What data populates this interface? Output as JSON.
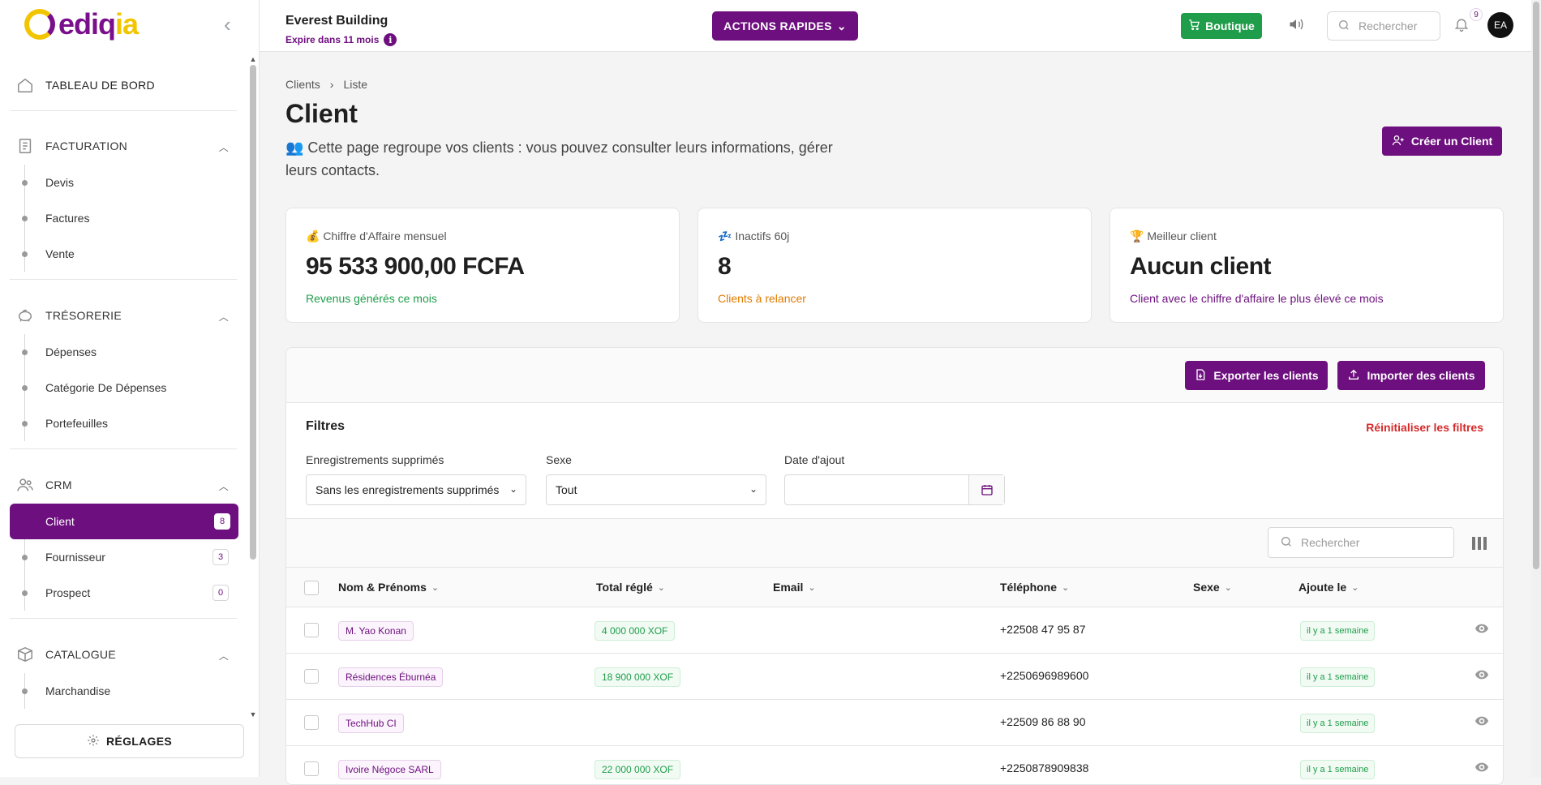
{
  "brand": {
    "logo_main": "ediq",
    "logo_accent": "ia"
  },
  "sidebar": {
    "dashboard": "TABLEAU DE BORD",
    "sections": [
      {
        "title": "FACTURATION",
        "items": [
          {
            "label": "Devis"
          },
          {
            "label": "Factures"
          },
          {
            "label": "Vente"
          }
        ]
      },
      {
        "title": "TRÉSORERIE",
        "items": [
          {
            "label": "Dépenses"
          },
          {
            "label": "Catégorie De Dépenses"
          },
          {
            "label": "Portefeuilles"
          }
        ]
      },
      {
        "title": "CRM",
        "items": [
          {
            "label": "Client",
            "count": "8",
            "active": true
          },
          {
            "label": "Fournisseur",
            "count": "3"
          },
          {
            "label": "Prospect",
            "count": "0"
          }
        ]
      },
      {
        "title": "CATALOGUE",
        "items": [
          {
            "label": "Marchandise"
          }
        ]
      }
    ],
    "settings": "RÉGLAGES"
  },
  "topbar": {
    "building": "Everest Building",
    "expire": "Expire dans 11 mois",
    "actions": "ACTIONS RAPIDES",
    "boutique": "Boutique",
    "search_placeholder": "Rechercher",
    "notif_count": "9",
    "avatar": "EA"
  },
  "page": {
    "breadcrumb": [
      "Clients",
      "Liste"
    ],
    "title": "Client",
    "description": "👥 Cette page regroupe vos clients : vous pouvez consulter leurs informations, gérer leurs contacts.",
    "create_button": "Créer un Client"
  },
  "cards": [
    {
      "label": "💰 Chiffre d'Affaire mensuel",
      "value": "95 533 900,00 FCFA",
      "sub": "Revenus générés ce mois",
      "sub_color": "#1f9d4a"
    },
    {
      "label": "💤 Inactifs 60j",
      "value": "8",
      "sub": "Clients à relancer",
      "sub_color": "#e07b00"
    },
    {
      "label": "🏆 Meilleur client",
      "value": "Aucun client",
      "sub": "Client avec le chiffre d'affaire le plus élevé ce mois",
      "sub_color": "#6d0f7e"
    }
  ],
  "panel": {
    "export": "Exporter les clients",
    "import": "Importer des clients",
    "filters_title": "Filtres",
    "reset": "Réinitialiser les filtres",
    "filter_deleted_label": "Enregistrements supprimés",
    "filter_deleted_value": "Sans les enregistrements supprimés",
    "filter_sex_label": "Sexe",
    "filter_sex_value": "Tout",
    "filter_date_label": "Date d'ajout",
    "table_search_placeholder": "Rechercher"
  },
  "table": {
    "columns": [
      "Nom & Prénoms",
      "Total réglé",
      "Email",
      "Téléphone",
      "Sexe",
      "Ajoute le"
    ],
    "rows": [
      {
        "name": "M. Yao Konan",
        "total": "4 000 000 XOF",
        "email": "",
        "phone": "+22508 47 95 87",
        "sex": "",
        "added": "il y a 1 semaine"
      },
      {
        "name": "Résidences Éburnéa",
        "total": "18 900 000 XOF",
        "email": "",
        "phone": "+2250696989600",
        "sex": "",
        "added": "il y a 1 semaine"
      },
      {
        "name": "TechHub CI",
        "total": "",
        "email": "",
        "phone": "+22509 86 88 90",
        "sex": "",
        "added": "il y a 1 semaine"
      },
      {
        "name": "Ivoire Négoce SARL",
        "total": "22 000 000 XOF",
        "email": "",
        "phone": "+2250878909838",
        "sex": "",
        "added": "il y a 1 semaine"
      }
    ]
  },
  "colors": {
    "accent": "#6d0f7e",
    "success": "#1f9d4a",
    "danger": "#d42a2a",
    "warning": "#e07b00"
  },
  "icons": [
    "home-icon",
    "invoice-icon",
    "piggy-bank-icon",
    "users-icon",
    "box-icon",
    "gear-icon",
    "chevron-up-icon",
    "chevron-down-icon",
    "search-icon",
    "bell-icon",
    "speaker-icon",
    "cart-icon",
    "calendar-icon",
    "eye-icon",
    "columns-icon",
    "download-icon",
    "upload-icon",
    "user-plus-icon",
    "info-icon"
  ]
}
